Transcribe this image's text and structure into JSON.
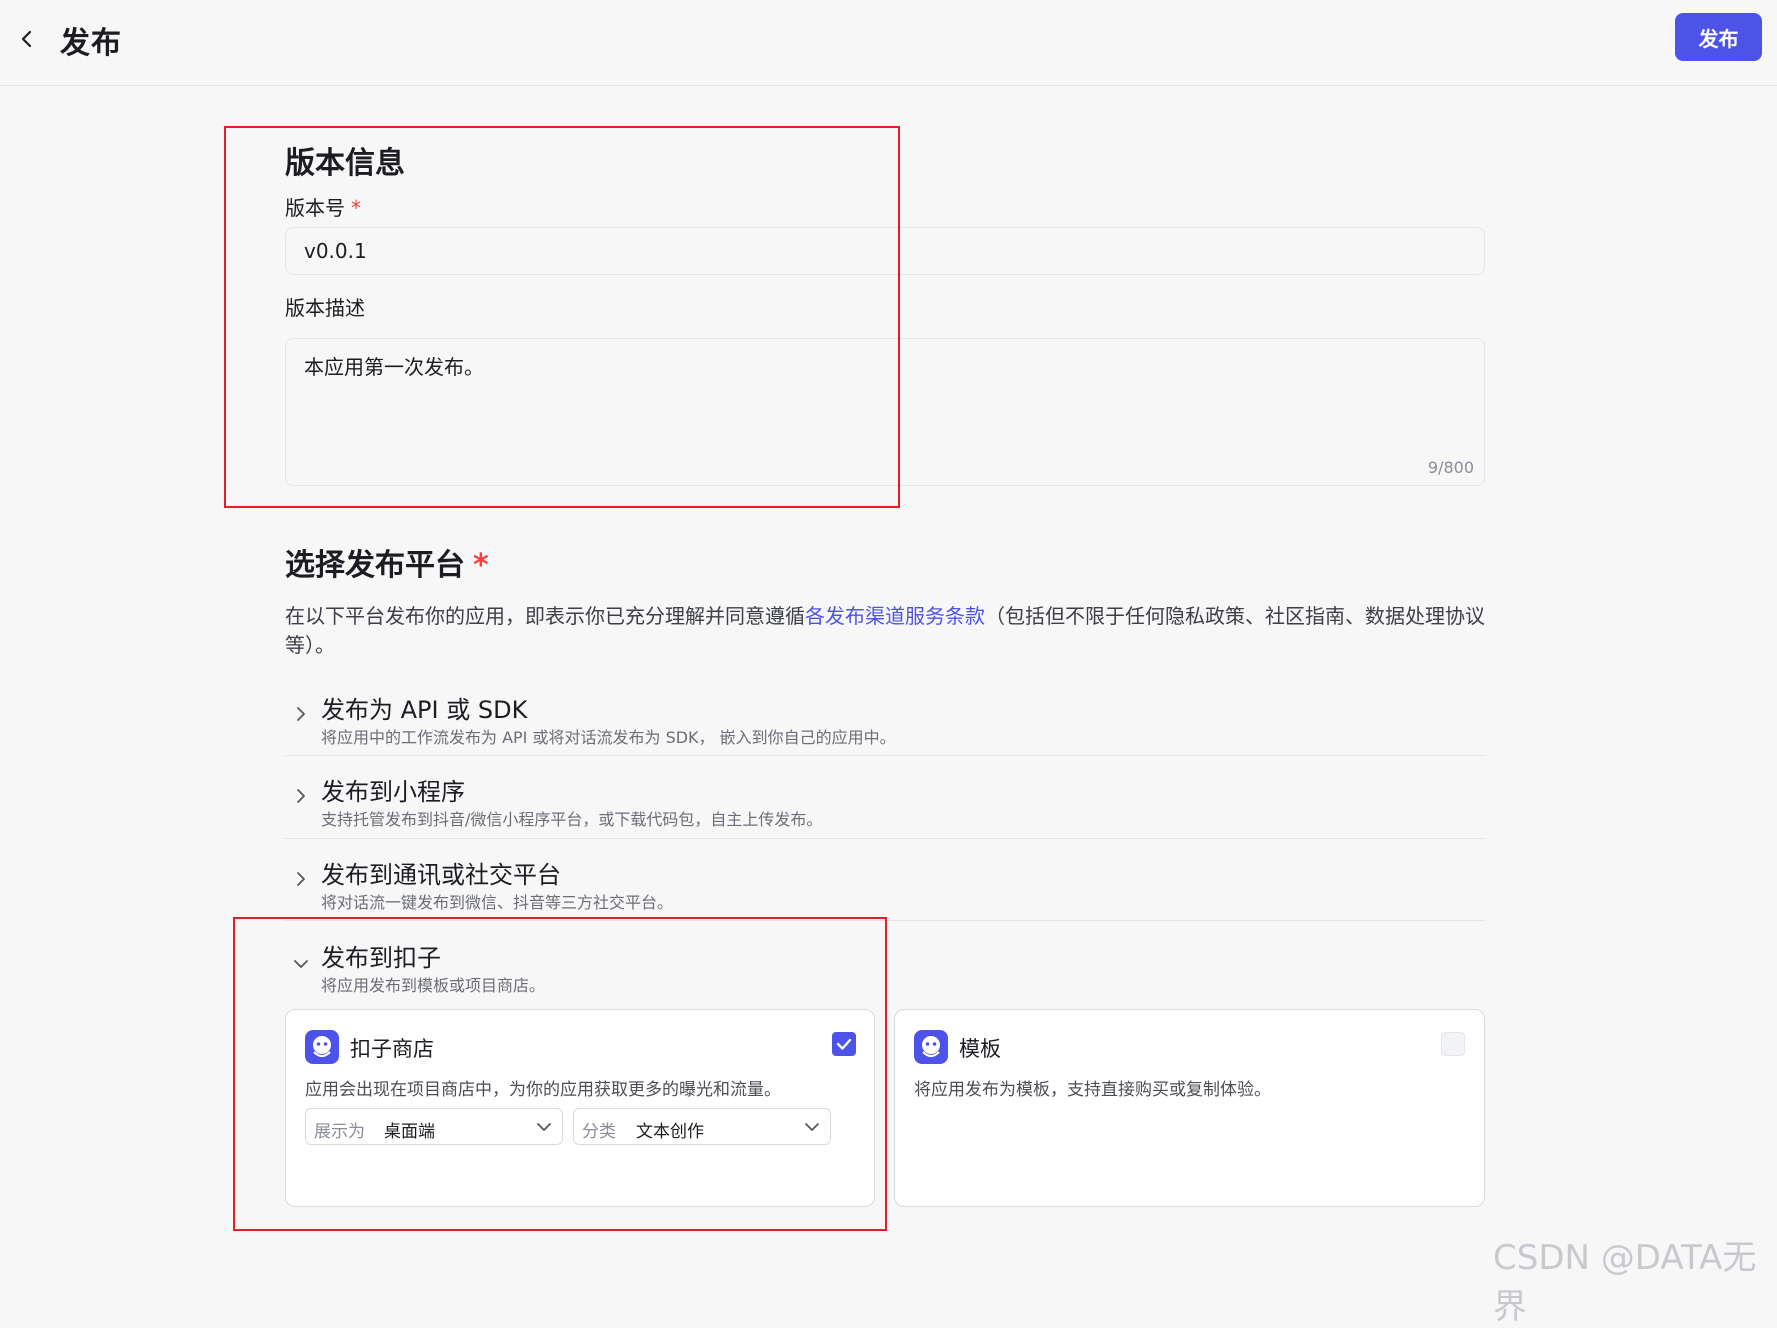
{
  "header": {
    "title": "发布",
    "publish_label": "发布"
  },
  "version_info": {
    "section_title": "版本信息",
    "version_label": "版本号",
    "required_mark": "*",
    "version_value": "v0.0.1",
    "desc_label": "版本描述",
    "desc_value": "本应用第一次发布。",
    "counter": "9/800"
  },
  "platform": {
    "section_title": "选择发布平台",
    "required_mark": "*",
    "desc_before": "在以下平台发布你的应用，即表示你已充分理解并同意遵循",
    "desc_link": "各发布渠道服务条款",
    "desc_after": "（包括但不限于任何隐私政策、社区指南、数据处理协议等）。",
    "items": [
      {
        "title": "发布为 API 或 SDK",
        "subtitle": "将应用中的工作流发布为 API 或将对话流发布为 SDK， 嵌入到你自己的应用中。",
        "expanded": false
      },
      {
        "title": "发布到小程序",
        "subtitle": "支持托管发布到抖音/微信小程序平台，或下载代码包，自主上传发布。",
        "expanded": false
      },
      {
        "title": "发布到通讯或社交平台",
        "subtitle": "将对话流一键发布到微信、抖音等三方社交平台。",
        "expanded": false
      },
      {
        "title": "发布到扣子",
        "subtitle": "将应用发布到模板或项目商店。",
        "expanded": true
      }
    ]
  },
  "cards": {
    "store": {
      "title": "扣子商店",
      "desc": "应用会出现在项目商店中，为你的应用获取更多的曝光和流量。",
      "checked": true,
      "display_label": "展示为",
      "display_value": "桌面端",
      "category_label": "分类",
      "category_value": "文本创作"
    },
    "template": {
      "title": "模板",
      "desc": "将应用发布为模板，支持直接购买或复制体验。",
      "checked": false
    }
  },
  "watermark": "CSDN @DATA无界",
  "colors": {
    "accent": "#4d53e8",
    "highlight_box": "#e51e27"
  }
}
